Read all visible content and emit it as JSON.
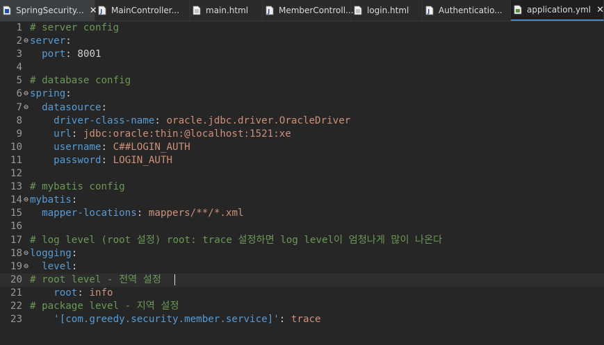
{
  "tabs": [
    {
      "label": "SpringSecurity...",
      "icon": "project-file-icon",
      "closable": true
    },
    {
      "label": "MainController...",
      "icon": "java-file-icon",
      "closable": false
    },
    {
      "label": "main.html",
      "icon": "html-file-icon",
      "closable": false
    },
    {
      "label": "MemberControll...",
      "icon": "java-file-icon",
      "closable": false
    },
    {
      "label": "login.html",
      "icon": "html-file-icon",
      "closable": false
    },
    {
      "label": "Authenticatio...",
      "icon": "java-file-icon",
      "closable": false
    },
    {
      "label": "application.yml",
      "icon": "yaml-file-icon",
      "closable": true
    }
  ],
  "close_symbol": "✕",
  "active_tab": "application.yml",
  "colors": {
    "comment": "#6a9955",
    "key": "#569cd6",
    "value": "#ce9178",
    "background": "#262626"
  },
  "lines": [
    {
      "num": "1",
      "fold": "",
      "indent": "",
      "comment": "# server config"
    },
    {
      "num": "2",
      "fold": "⊖",
      "indent": "",
      "key": "server",
      "sep": ":"
    },
    {
      "num": "3",
      "fold": "",
      "indent": "  ",
      "key": "port",
      "sep": ": ",
      "val": "8001",
      "valtype": "number"
    },
    {
      "num": "4",
      "fold": "",
      "indent": ""
    },
    {
      "num": "5",
      "fold": "",
      "indent": "",
      "comment": "# database config"
    },
    {
      "num": "6",
      "fold": "⊖",
      "indent": "",
      "key": "spring",
      "sep": ":"
    },
    {
      "num": "7",
      "fold": "⊖",
      "indent": "  ",
      "key": "datasource",
      "sep": ":"
    },
    {
      "num": "8",
      "fold": "",
      "indent": "    ",
      "key": "driver-class-name",
      "sep": ": ",
      "val": "oracle.jdbc.driver.OracleDriver",
      "valtype": "value"
    },
    {
      "num": "9",
      "fold": "",
      "indent": "    ",
      "key": "url",
      "sep": ": ",
      "val": "jdbc:oracle:thin:@localhost:1521:xe",
      "valtype": "value"
    },
    {
      "num": "10",
      "fold": "",
      "indent": "    ",
      "key": "username",
      "sep": ": ",
      "val": "C##LOGIN_AUTH",
      "valtype": "value"
    },
    {
      "num": "11",
      "fold": "",
      "indent": "    ",
      "key": "password",
      "sep": ": ",
      "val": "LOGIN_AUTH",
      "valtype": "value"
    },
    {
      "num": "12",
      "fold": "",
      "indent": ""
    },
    {
      "num": "13",
      "fold": "",
      "indent": "",
      "comment": "# mybatis config"
    },
    {
      "num": "14",
      "fold": "⊖",
      "indent": "",
      "key": "mybatis",
      "sep": ":"
    },
    {
      "num": "15",
      "fold": "",
      "indent": "  ",
      "key": "mapper-locations",
      "sep": ": ",
      "val": "mappers/**/*.xml",
      "valtype": "value"
    },
    {
      "num": "16",
      "fold": "",
      "indent": ""
    },
    {
      "num": "17",
      "fold": "",
      "indent": "",
      "comment": "# log level (root 설정) root: trace 설정하면 log level이 엄청나게 많이 나온다"
    },
    {
      "num": "18",
      "fold": "⊖",
      "indent": "",
      "key": "logging",
      "sep": ":"
    },
    {
      "num": "19",
      "fold": "⊖",
      "indent": "  ",
      "key": "level",
      "sep": ":"
    },
    {
      "num": "20",
      "fold": "",
      "indent": "",
      "comment": "# root level - 전역 설정  ",
      "current": true
    },
    {
      "num": "21",
      "fold": "",
      "indent": "    ",
      "key": "root",
      "sep": ": ",
      "val": "info",
      "valtype": "value"
    },
    {
      "num": "22",
      "fold": "",
      "indent": "",
      "comment": "# package level - 지역 설정"
    },
    {
      "num": "23",
      "fold": "",
      "indent": "    ",
      "key": "'[com.greedy.security.member.service]'",
      "sep": ": ",
      "val": "trace",
      "valtype": "value"
    }
  ]
}
